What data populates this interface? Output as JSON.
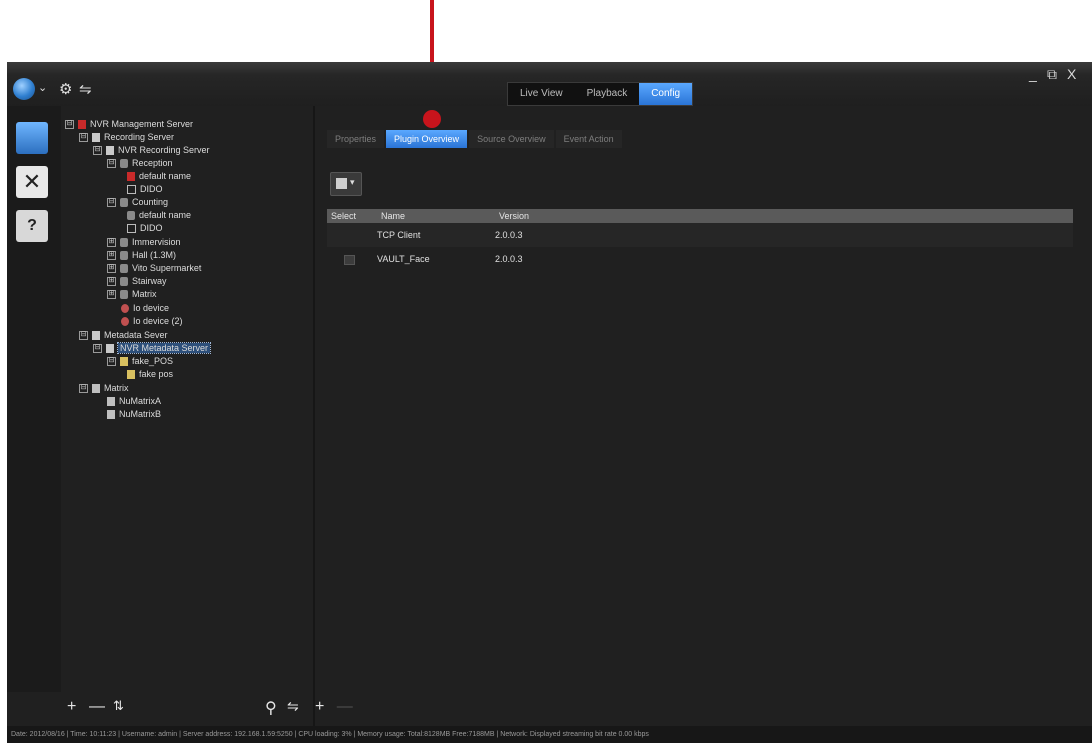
{
  "window": {
    "minimize": "_",
    "restore": "⧉",
    "close": "X"
  },
  "toolbar": {
    "logo_caret": "⌄",
    "settings_icon": "⚙",
    "link_icon": "⇋"
  },
  "modes": [
    {
      "label": "Live View",
      "active": false
    },
    {
      "label": "Playback",
      "active": false
    },
    {
      "label": "Config",
      "active": true
    }
  ],
  "tree": {
    "items": [
      {
        "toggle": "⊟",
        "label": "NVR Management Server"
      },
      {
        "toggle": "⊟",
        "label": "Recording Server"
      },
      {
        "toggle": "⊟",
        "label": "NVR Recording Server"
      },
      {
        "toggle": "⊟",
        "label": "Reception"
      },
      {
        "toggle": "",
        "label": "default name"
      },
      {
        "toggle": "",
        "label": "DIDO"
      },
      {
        "toggle": "⊟",
        "label": "Counting"
      },
      {
        "toggle": "",
        "label": "default name"
      },
      {
        "toggle": "",
        "label": "DIDO"
      },
      {
        "toggle": "⊞",
        "label": "Immervision"
      },
      {
        "toggle": "⊞",
        "label": "Hall (1.3M)"
      },
      {
        "toggle": "⊞",
        "label": "Vito Supermarket"
      },
      {
        "toggle": "⊞",
        "label": "Stairway"
      },
      {
        "toggle": "⊞",
        "label": "Matrix"
      },
      {
        "toggle": "",
        "label": "Io device"
      },
      {
        "toggle": "",
        "label": "Io device (2)"
      },
      {
        "toggle": "⊟",
        "label": "Metadata Sever"
      },
      {
        "toggle": "⊟",
        "label": "NVR Metadata Server"
      },
      {
        "toggle": "⊟",
        "label": "fake_POS"
      },
      {
        "toggle": "",
        "label": "fake pos"
      },
      {
        "toggle": "⊟",
        "label": "Matrix"
      },
      {
        "toggle": "",
        "label": "NuMatrixA"
      },
      {
        "toggle": "",
        "label": "NuMatrixB"
      }
    ],
    "tools": {
      "add": "+",
      "remove": "—",
      "sort": "⇅",
      "search": "⚲",
      "link": "⇋"
    }
  },
  "subtabs": [
    {
      "label": "Properties",
      "active": false
    },
    {
      "label": "Plugin Overview",
      "active": true
    },
    {
      "label": "Source Overview",
      "active": false
    },
    {
      "label": "Event Action",
      "active": false
    }
  ],
  "plugin_table": {
    "headers": [
      "Select",
      "Name",
      "Version"
    ],
    "rows": [
      {
        "name": "TCP Client",
        "version": "2.0.0.3"
      },
      {
        "name": "VAULT_Face",
        "version": "2.0.0.3"
      }
    ]
  },
  "right_tools": {
    "add": "+",
    "remove": "—"
  },
  "status_bar": "Date: 2012/08/16  |  Time: 10:11:23  |  Username: admin  |  Server address: 192.168.1.59:5250  |  CPU loading: 3%  |  Memory usage: Total:8128MB Free:7188MB  |  Network: Displayed streaming bit rate    0.00 kbps"
}
